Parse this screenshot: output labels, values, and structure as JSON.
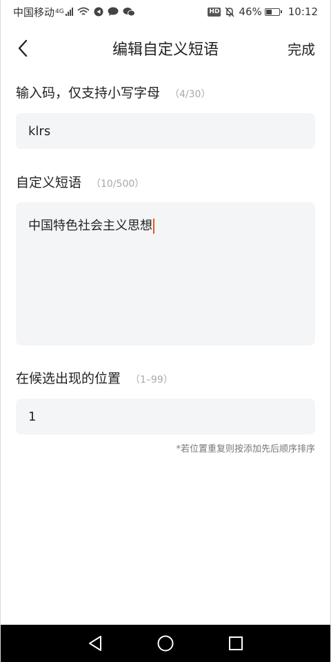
{
  "status_bar": {
    "carrier": "中国移动",
    "network": "4G",
    "hd": "HD",
    "battery": "46%",
    "battery_level": 0.46,
    "time": "10:12"
  },
  "header": {
    "title": "编辑自定义短语",
    "done_label": "完成"
  },
  "input_code": {
    "label": "输入码，仅支持小写字母",
    "counter": "（4/30）",
    "value": "klrs"
  },
  "phrase": {
    "label": "自定义短语",
    "counter": "（10/500）",
    "value": "中国特色社会主义思想"
  },
  "position": {
    "label": "在候选出现的位置",
    "counter": "（1–99）",
    "value": "1"
  },
  "note": "*若位置重复则按添加先后顺序排序",
  "nav": {
    "back": "triangle-back-icon",
    "home": "circle-home-icon",
    "recents": "square-recents-icon"
  }
}
